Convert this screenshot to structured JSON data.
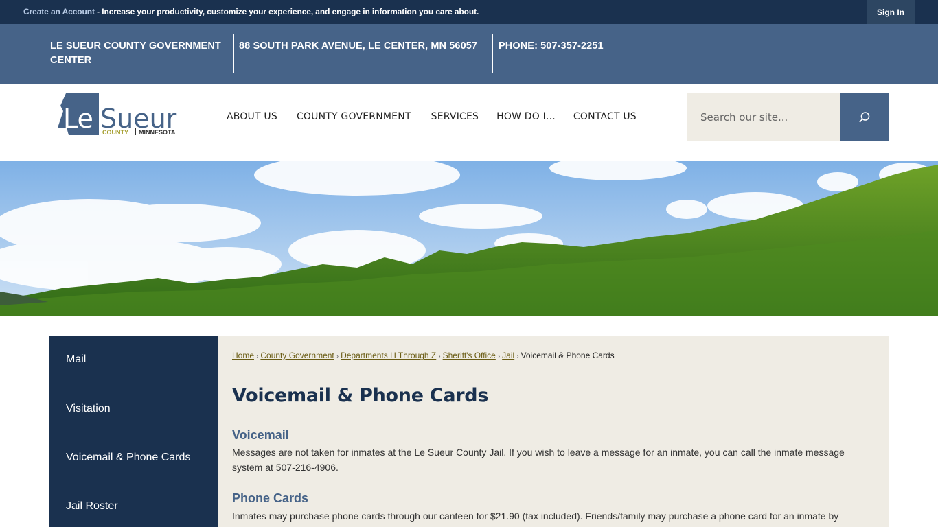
{
  "topbar": {
    "create_account_label": "Create an Account",
    "promo_text": " - Increase your productivity, customize your experience, and engage in information you care about.",
    "signin_label": "Sign In"
  },
  "infobar": {
    "org_name": "LE SUEUR COUNTY GOVERNMENT CENTER",
    "address": "88 SOUTH PARK AVENUE, LE CENTER, MN 56057",
    "phone": "PHONE: 507-357-2251"
  },
  "logo": {
    "name": "Le Sueur",
    "county": "COUNTY",
    "state": "MINNESOTA",
    "colors": {
      "primary": "#466388",
      "accent": "#a39c2a"
    }
  },
  "nav": {
    "items": [
      {
        "label": "ABOUT US"
      },
      {
        "label": "COUNTY GOVERNMENT"
      },
      {
        "label": "SERVICES"
      },
      {
        "label": "HOW DO I..."
      },
      {
        "label": "CONTACT US"
      }
    ]
  },
  "search": {
    "placeholder": "Search our site...",
    "value": "",
    "icon": "search-icon"
  },
  "sidebar": {
    "items": [
      {
        "label": "Mail"
      },
      {
        "label": "Visitation"
      },
      {
        "label": "Voicemail & Phone Cards"
      },
      {
        "label": "Jail Roster"
      }
    ]
  },
  "breadcrumb": {
    "items": [
      {
        "label": "Home"
      },
      {
        "label": "County Government"
      },
      {
        "label": "Departments H Through Z"
      },
      {
        "label": "Sheriff's Office"
      },
      {
        "label": "Jail"
      }
    ],
    "current": "Voicemail & Phone Cards",
    "separator": "›"
  },
  "main": {
    "title": "Voicemail & Phone Cards",
    "sections": [
      {
        "heading": "Voicemail",
        "text": "Messages are not taken for inmates at the Le Sueur County Jail. If you wish to leave a message for an inmate, you can call the inmate message system at 507-216-4906."
      },
      {
        "heading": "Phone Cards",
        "text": "Inmates may purchase phone cards through our canteen for $21.90 (tax included). Friends/family may purchase a phone card for an inmate by"
      }
    ]
  },
  "colors": {
    "navy": "#1a314f",
    "slate_blue": "#466388",
    "beige": "#efece4",
    "link_olive": "#6a5c14"
  }
}
